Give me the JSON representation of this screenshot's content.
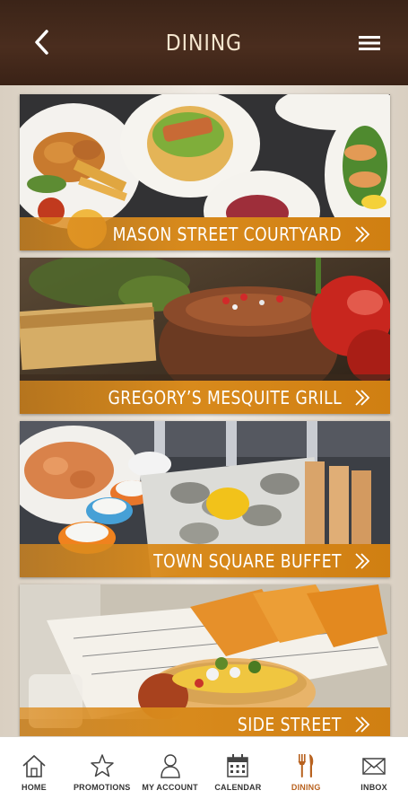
{
  "header": {
    "title": "DINING",
    "back_icon": "back-arrow-icon",
    "menu_icon": "hamburger-menu-icon"
  },
  "colors": {
    "header_bg": "#3b2418",
    "accent_bar": "#d88a1c",
    "active_nav": "#b8621f"
  },
  "restaurants": [
    {
      "name": "MASON STREET COURTYARD",
      "icon": "chevron-right-icon"
    },
    {
      "name": "GREGORY’S MESQUITE GRILL",
      "icon": "chevron-right-icon"
    },
    {
      "name": "TOWN SQUARE BUFFET",
      "icon": "chevron-right-icon"
    },
    {
      "name": "SIDE STREET",
      "icon": "chevron-right-icon"
    }
  ],
  "nav": [
    {
      "label": "HOME",
      "icon": "home-icon",
      "active": false
    },
    {
      "label": "PROMOTIONS",
      "icon": "star-icon",
      "active": false
    },
    {
      "label": "MY ACCOUNT",
      "icon": "person-icon",
      "active": false
    },
    {
      "label": "CALENDAR",
      "icon": "calendar-icon",
      "active": false
    },
    {
      "label": "DINING",
      "icon": "fork-knife-icon",
      "active": true
    },
    {
      "label": "INBOX",
      "icon": "envelope-icon",
      "active": false
    }
  ]
}
